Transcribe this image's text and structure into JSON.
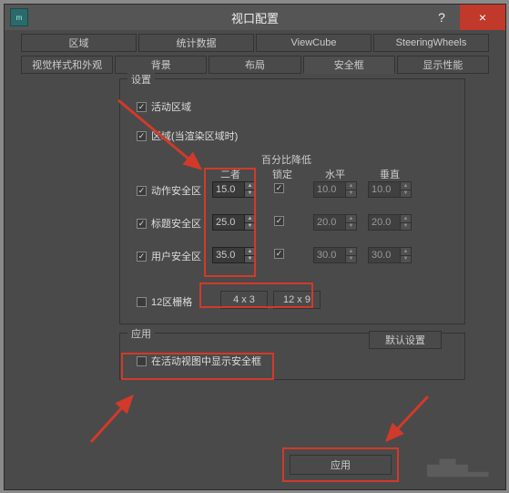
{
  "titlebar": {
    "icon_text": "m",
    "title": "视口配置",
    "help": "?",
    "close": "×"
  },
  "tabs": {
    "row1": [
      {
        "label": "区域"
      },
      {
        "label": "统计数据"
      },
      {
        "label": "ViewCube"
      },
      {
        "label": "SteeringWheels"
      }
    ],
    "row2": [
      {
        "label": "视觉样式和外观"
      },
      {
        "label": "背景"
      },
      {
        "label": "布局"
      },
      {
        "label": "安全框",
        "active": true
      },
      {
        "label": "显示性能"
      }
    ]
  },
  "settings_group": {
    "title": "设置",
    "active_region": {
      "label": "活动区域",
      "checked": true
    },
    "region_when_rendering": {
      "label": "区域(当渲染区域时)",
      "checked": true
    },
    "percent_reduce_title": "百分比降低",
    "col_both": "二者",
    "col_lock": "锁定",
    "col_horizontal": "水平",
    "col_vertical": "垂直",
    "rows": [
      {
        "label": "动作安全区",
        "checked": true,
        "both": "15.0",
        "lock": true,
        "h": "10.0",
        "v": "10.0"
      },
      {
        "label": "标题安全区",
        "checked": true,
        "both": "25.0",
        "lock": true,
        "h": "20.0",
        "v": "20.0"
      },
      {
        "label": "用户安全区",
        "checked": true,
        "both": "35.0",
        "lock": true,
        "h": "30.0",
        "v": "30.0"
      }
    ],
    "grid_12": {
      "label": "12区栅格",
      "checked": false
    },
    "btn_4x3": "4 x 3",
    "btn_12x9": "12 x 9"
  },
  "apply_group": {
    "title": "应用",
    "show_safe_in_active": {
      "label": "在活动视图中显示安全框",
      "checked": false
    },
    "default_btn": "默认设置"
  },
  "bottom": {
    "apply_btn": "应用"
  }
}
